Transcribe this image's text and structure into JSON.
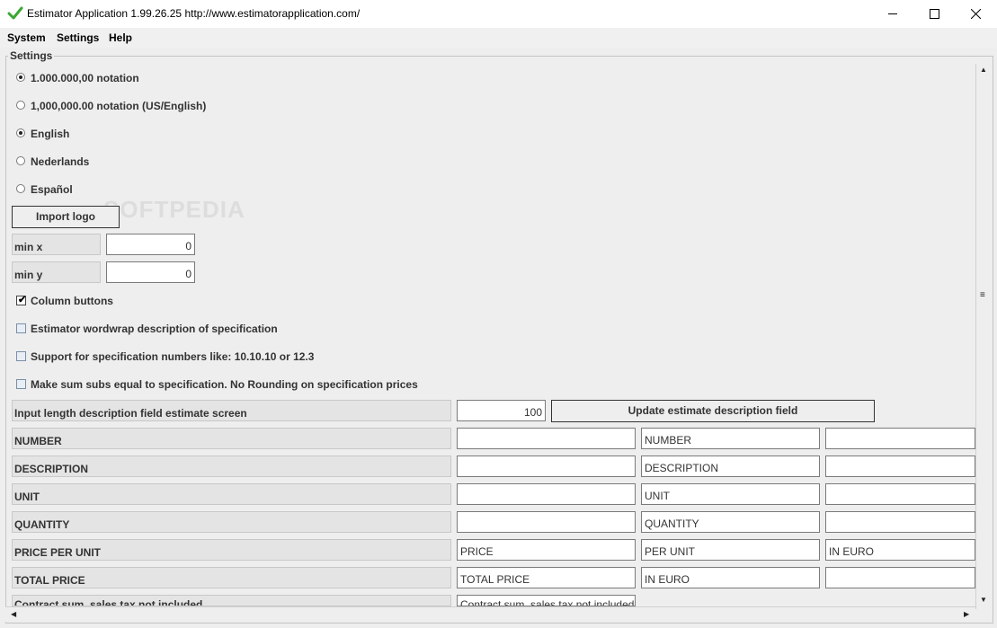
{
  "window": {
    "title": "Estimator Application 1.99.26.25 http://www.estimatorapplication.com/"
  },
  "menu": [
    "System",
    "Settings",
    "Help"
  ],
  "settings": {
    "legend": "Settings",
    "notation": [
      {
        "label": "1.000.000,00 notation",
        "selected": true
      },
      {
        "label": "1,000,000.00 notation (US/English)",
        "selected": false
      }
    ],
    "languages": [
      {
        "label": "English",
        "selected": true
      },
      {
        "label": "Nederlands",
        "selected": false
      },
      {
        "label": "Español",
        "selected": false
      }
    ],
    "import_logo": "Import logo",
    "min_x": {
      "label": "min x",
      "value": "0"
    },
    "min_y": {
      "label": "min y",
      "value": "0"
    },
    "checkboxes": [
      {
        "label": "Column buttons",
        "checked": true
      },
      {
        "label": "Estimator wordwrap description of specification",
        "checked": false
      },
      {
        "label": "Support for specification numbers like: 10.10.10 or 12.3",
        "checked": false
      },
      {
        "label": "Make sum subs equal to specification. No Rounding on specification prices",
        "checked": false
      }
    ],
    "input_length": {
      "label": "Input length description field estimate screen",
      "value": "100"
    },
    "update_button": "Update estimate description field",
    "fields": [
      {
        "label": "NUMBER",
        "col1": "",
        "col2": "NUMBER",
        "col3": ""
      },
      {
        "label": "DESCRIPTION",
        "col1": "",
        "col2": "DESCRIPTION",
        "col3": ""
      },
      {
        "label": "UNIT",
        "col1": "",
        "col2": "UNIT",
        "col3": ""
      },
      {
        "label": "QUANTITY",
        "col1": "",
        "col2": "QUANTITY",
        "col3": ""
      },
      {
        "label": "PRICE PER UNIT",
        "col1": "PRICE",
        "col2": "PER UNIT",
        "col3": "IN EURO"
      },
      {
        "label": "TOTAL PRICE",
        "col1": "TOTAL PRICE",
        "col2": "IN EURO",
        "col3": ""
      },
      {
        "label": "Contract sum, sales tax not included",
        "col1": "Contract sum, sales tax not included"
      }
    ]
  },
  "watermark": "SOFTPEDIA"
}
